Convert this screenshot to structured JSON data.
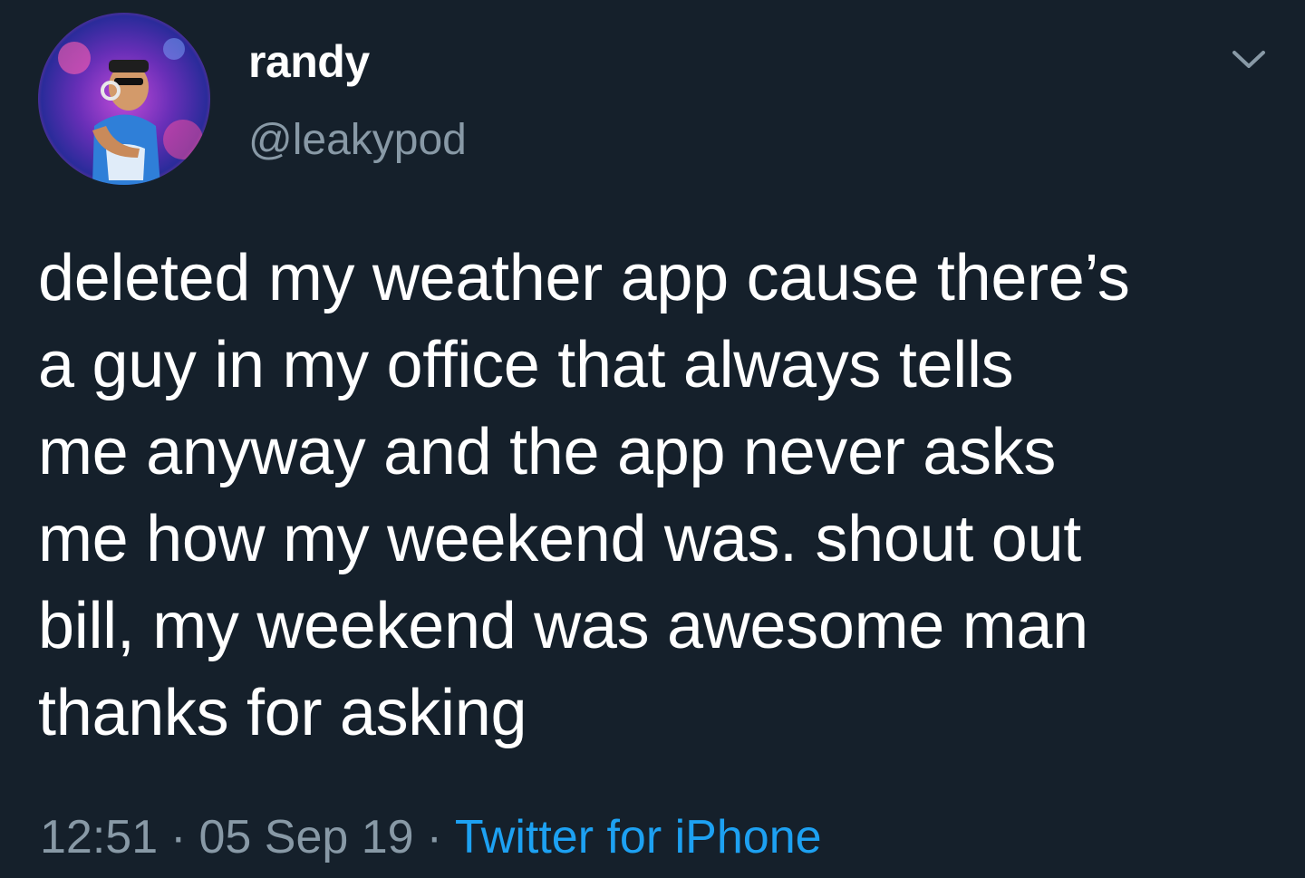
{
  "tweet": {
    "author": {
      "display_name": "randy",
      "handle": "@leakypod"
    },
    "text": "deleted my weather app cause there’s\na guy in my office that always tells\nme anyway and the app never asks\nme how my weekend was. shout out\nbill, my weekend was awesome man\nthanks for asking",
    "time": "12:51",
    "separator": "·",
    "date": "05 Sep 19",
    "source": "Twitter for iPhone"
  },
  "icons": {
    "menu": "chevron-down-icon"
  },
  "colors": {
    "background": "#15202b",
    "text": "#ffffff",
    "secondary_text": "#8899a6",
    "link": "#1da1f2"
  }
}
